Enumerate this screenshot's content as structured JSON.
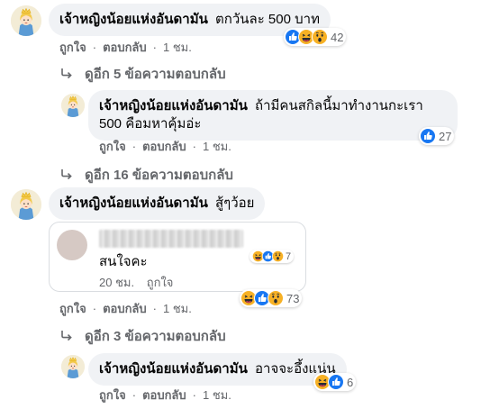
{
  "comments": [
    {
      "author": "เจ้าหญิงน้อยแห่งอันดามัน",
      "text": "ตกวันละ 500 บาท",
      "like": "ถูกใจ",
      "reply": "ตอบกลับ",
      "time": "1 ชม.",
      "reaction_count": "42"
    },
    {
      "author": "เจ้าหญิงน้อยแห่งอันดามัน",
      "text": "ถ้ามีคนสกิลนี้มาทำงานกะเรา",
      "text_line2": "500 คือมหาคุ้มอ่ะ",
      "like": "ถูกใจ",
      "reply": "ตอบกลับ",
      "time": "1 ชม.",
      "reaction_count": "27"
    },
    {
      "author": "เจ้าหญิงน้อยแห่งอันดามัน",
      "text": "สู้ๆว้อย",
      "like": "ถูกใจ",
      "reply": "ตอบกลับ",
      "time": "1 ชม.",
      "reaction_count": "73"
    },
    {
      "author": "เจ้าหญิงน้อยแห่งอันดามัน",
      "text": "อาจจะอึ้งแน่น",
      "like": "ถูกใจ",
      "reply": "ตอบกลับ",
      "time": "1 ชม.",
      "reaction_count": "6"
    }
  ],
  "more_replies": [
    "ดูอีก 5 ข้อความตอบกลับ",
    "ดูอีก 16 ข้อความตอบกลับ",
    "ดูอีก 3 ข้อความตอบกลับ"
  ],
  "quoted_card": {
    "text": "สนใจคะ",
    "time": "20 ชม.",
    "like": "ถูกใจ",
    "reaction_count": "7"
  },
  "colors": {
    "bubble_bg": "#f0f2f5",
    "meta_gray": "#65676b",
    "like_blue": "#1877f2",
    "love_red": "#f33e58",
    "haha_yellow": "#f7b125"
  },
  "icons": [
    "like-reaction-icon",
    "haha-reaction-icon",
    "wow-reaction-icon",
    "reply-arrow-icon",
    "princess-avatar"
  ]
}
